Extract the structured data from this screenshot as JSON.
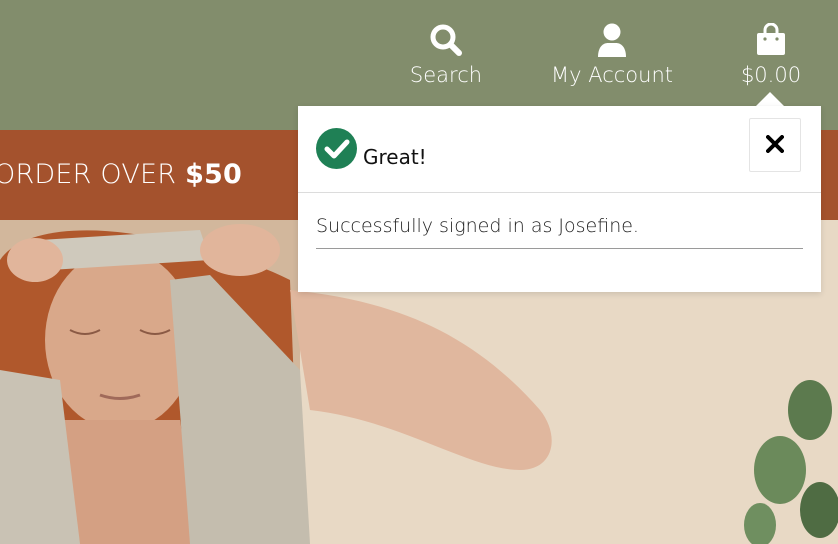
{
  "nav": {
    "search_label": "Search",
    "account_label": "My Account",
    "bag_total": "$0.00",
    "bar_color": "#828d6c"
  },
  "promo": {
    "text_prefix": "ORDER OVER ",
    "text_amount": "$50",
    "bar_color": "#a4522d"
  },
  "toast": {
    "title": "Great!",
    "message": "Successfully signed in as Josefine.",
    "icon": "check-circle-icon",
    "close_icon": "close-icon",
    "accent_color": "#1f8055"
  },
  "hero": {
    "image": "woman-with-linen-apron-photo"
  }
}
